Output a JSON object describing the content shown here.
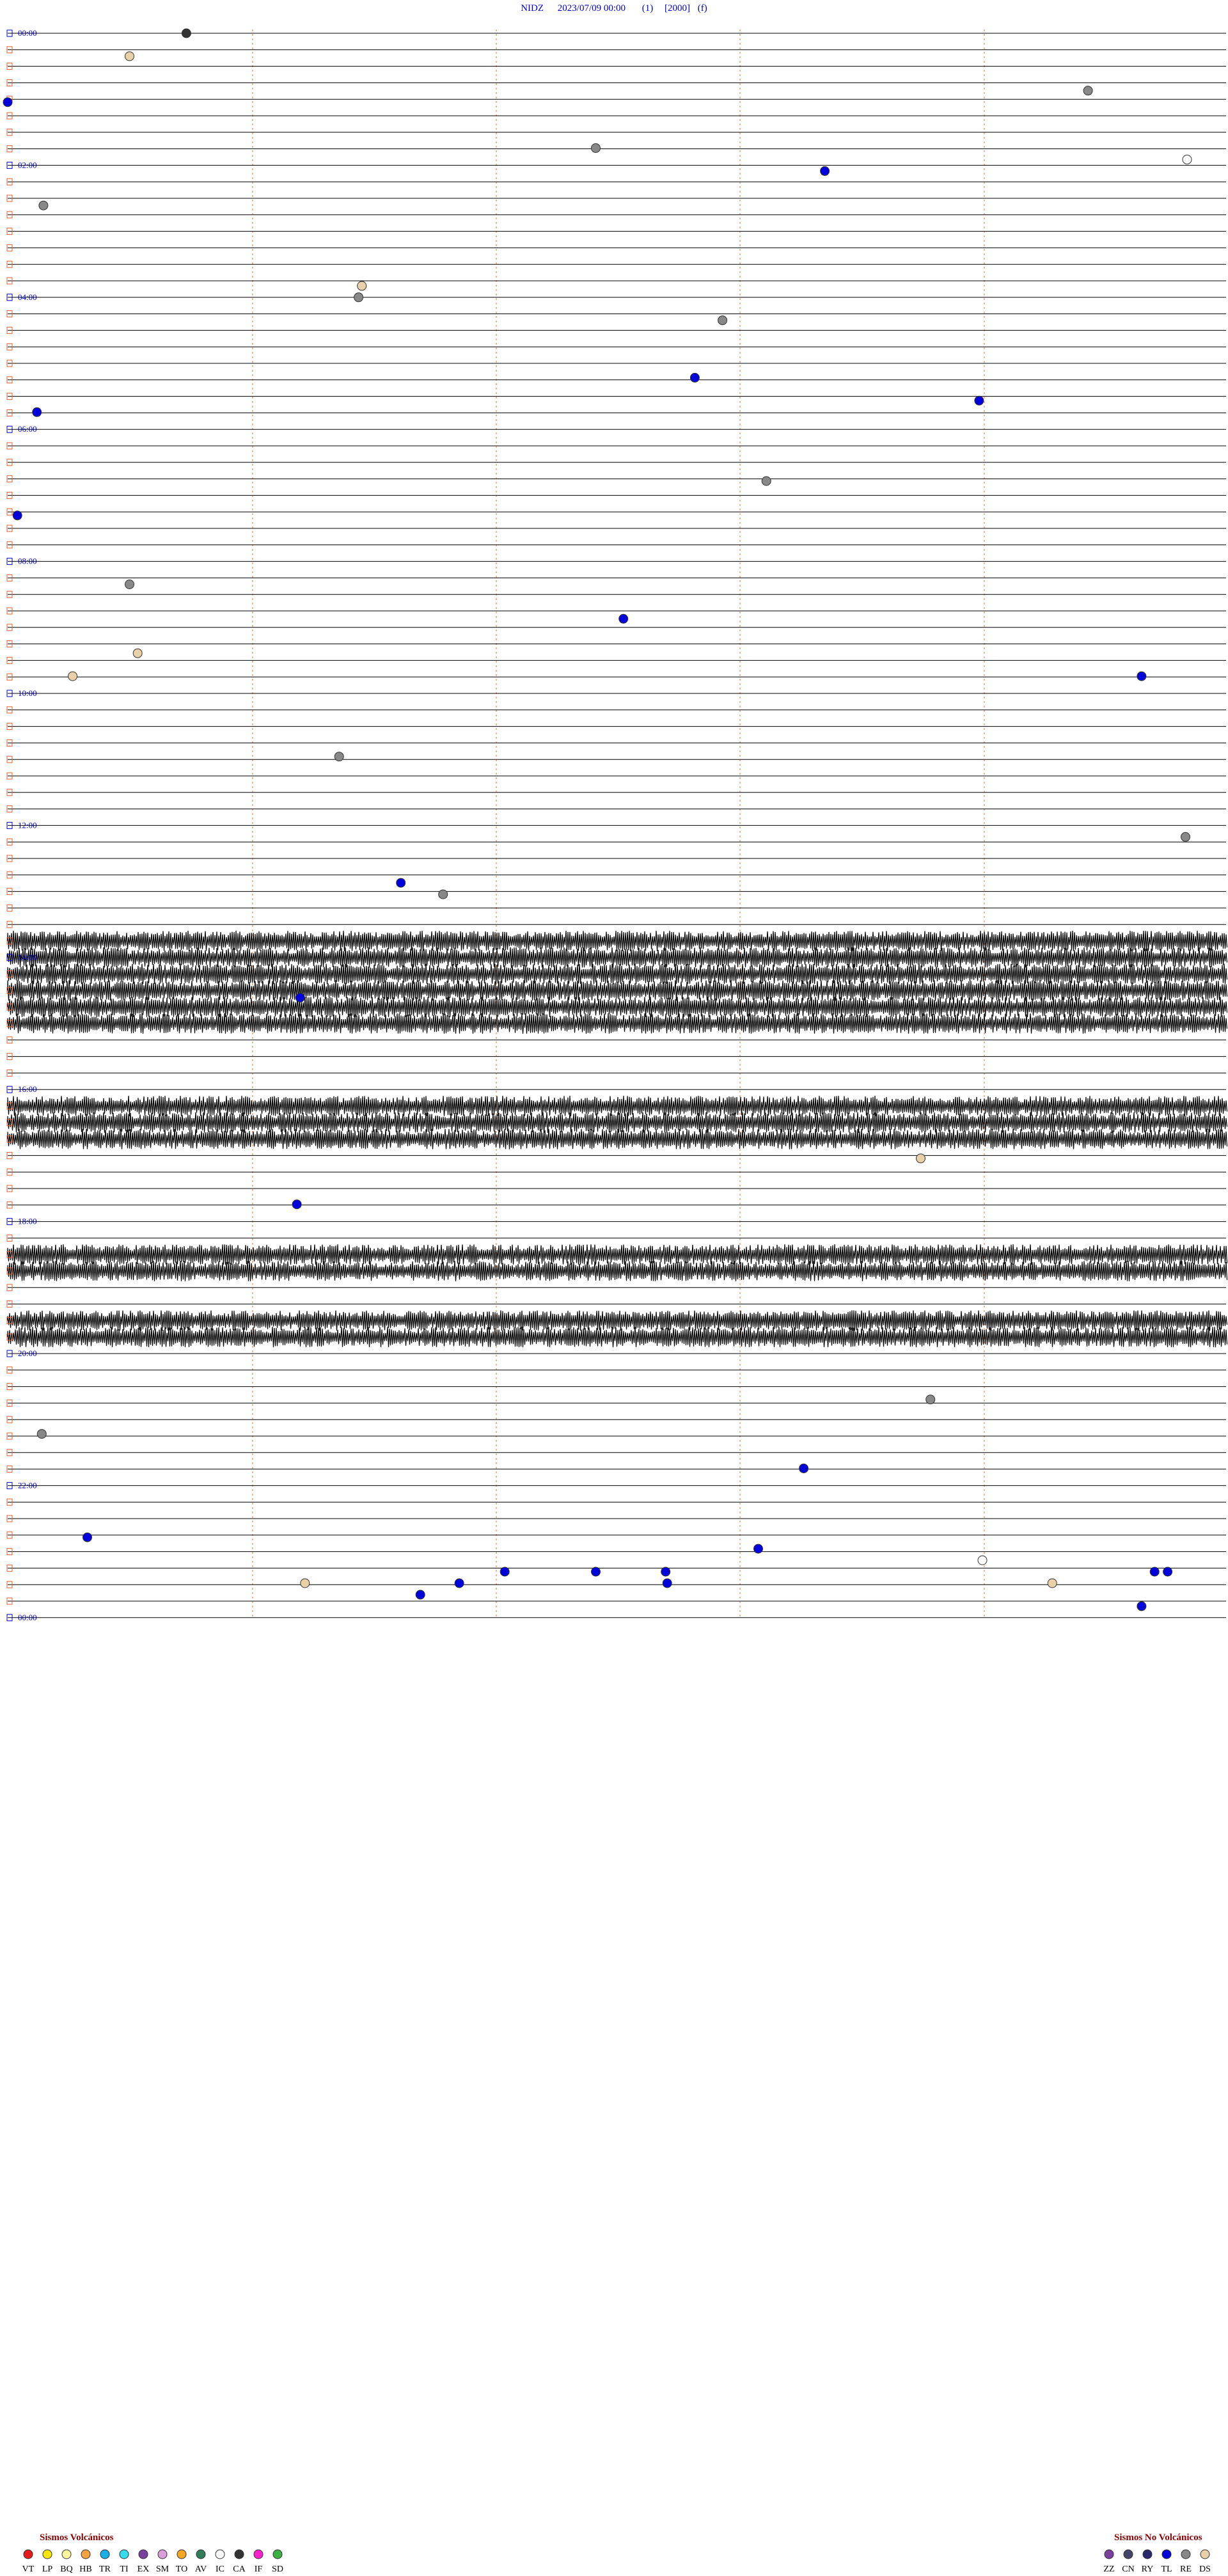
{
  "title": {
    "station": "NIDZ",
    "date": "2023/07/09 00:00",
    "param1": "(1)",
    "param2": "[2000]",
    "param3": "(f)"
  },
  "legend": {
    "volcanic_title": "Sismos Volcánicos",
    "volcanic": [
      {
        "code": "VT",
        "color": "#e41a1c"
      },
      {
        "code": "LP",
        "color": "#ffe600"
      },
      {
        "code": "BQ",
        "color": "#fff7a0"
      },
      {
        "code": "HB",
        "color": "#f4a340"
      },
      {
        "code": "TR",
        "color": "#1ab0e6"
      },
      {
        "code": "TI",
        "color": "#33ddee"
      },
      {
        "code": "EX",
        "color": "#7b3fa0"
      },
      {
        "code": "SM",
        "color": "#d9a0d9"
      },
      {
        "code": "TO",
        "color": "#f5a623"
      },
      {
        "code": "AV",
        "color": "#2e7d5b"
      },
      {
        "code": "IC",
        "color": "#ffffff"
      },
      {
        "code": "CA",
        "color": "#333333"
      },
      {
        "code": "IF",
        "color": "#ff22cc"
      },
      {
        "code": "SD",
        "color": "#3cb043"
      }
    ],
    "nonvolcanic_title": "Sismos No Volcánicos",
    "nonvolcanic": [
      {
        "code": "ZZ",
        "color": "#7b3fa0"
      },
      {
        "code": "CN",
        "color": "#444466"
      },
      {
        "code": "RY",
        "color": "#2a2a6a"
      },
      {
        "code": "TL",
        "color": "#0000dd"
      },
      {
        "code": "RE",
        "color": "#888888"
      },
      {
        "code": "DS",
        "color": "#e8d0a8"
      }
    ]
  },
  "chart_data": {
    "type": "scatter",
    "trace_rows": 96,
    "row_minutes": 15,
    "hour_labels": [
      "00:00",
      "02:00",
      "04:00",
      "06:00",
      "08:00",
      "10:00",
      "12:00",
      "14:00",
      "16:00",
      "18:00",
      "20:00",
      "22:00",
      "00:00"
    ],
    "noisy_row_ranges": [
      [
        55,
        60
      ],
      [
        65,
        67
      ],
      [
        74,
        75
      ],
      [
        78,
        79
      ]
    ],
    "events": [
      {
        "row": 0,
        "minute": 11.0,
        "type": "CA"
      },
      {
        "row": 2,
        "minute": 7.5,
        "type": "DS"
      },
      {
        "row": 5,
        "minute": 66.5,
        "type": "RE"
      },
      {
        "row": 6,
        "minute": 0.0,
        "type": "TL"
      },
      {
        "row": 10,
        "minute": 36.2,
        "type": "RE"
      },
      {
        "row": 11,
        "minute": 72.6,
        "type": "IC"
      },
      {
        "row": 12,
        "minute": 50.3,
        "type": "TL"
      },
      {
        "row": 15,
        "minute": 2.2,
        "type": "RE"
      },
      {
        "row": 22,
        "minute": 21.8,
        "type": "DS"
      },
      {
        "row": 23,
        "minute": 21.6,
        "type": "RE"
      },
      {
        "row": 25,
        "minute": 44.0,
        "type": "RE"
      },
      {
        "row": 30,
        "minute": 42.3,
        "type": "TL"
      },
      {
        "row": 32,
        "minute": 59.8,
        "type": "TL"
      },
      {
        "row": 33,
        "minute": 1.8,
        "type": "TL"
      },
      {
        "row": 39,
        "minute": 46.7,
        "type": "RE"
      },
      {
        "row": 42,
        "minute": 0.6,
        "type": "TL"
      },
      {
        "row": 48,
        "minute": 7.5,
        "type": "RE"
      },
      {
        "row": 51,
        "minute": 37.9,
        "type": "TL"
      },
      {
        "row": 54,
        "minute": 8.0,
        "type": "DS"
      },
      {
        "row": 56,
        "minute": 4.0,
        "type": "DS"
      },
      {
        "row": 56,
        "minute": 69.8,
        "type": "TL"
      },
      {
        "row": 63,
        "minute": 20.4,
        "type": "RE"
      },
      {
        "row": 70,
        "minute": 72.5,
        "type": "RE"
      },
      {
        "row": 74,
        "minute": 24.2,
        "type": "TL"
      },
      {
        "row": 75,
        "minute": 26.8,
        "type": "RE"
      },
      {
        "row": 84,
        "minute": 18.0,
        "type": "TL"
      },
      {
        "row": 98,
        "minute": 56.2,
        "type": "DS"
      },
      {
        "row": 102,
        "minute": 17.8,
        "type": "TL"
      },
      {
        "row": 119,
        "minute": 56.8,
        "type": "RE"
      },
      {
        "row": 122,
        "minute": 2.1,
        "type": "RE"
      },
      {
        "row": 125,
        "minute": 49.0,
        "type": "TL"
      },
      {
        "row": 131,
        "minute": 4.9,
        "type": "TL"
      },
      {
        "row": 132,
        "minute": 46.2,
        "type": "TL"
      },
      {
        "row": 133,
        "minute": 60.0,
        "type": "IC"
      },
      {
        "row": 134,
        "minute": 30.6,
        "type": "TL"
      },
      {
        "row": 134,
        "minute": 36.2,
        "type": "TL"
      },
      {
        "row": 134,
        "minute": 40.5,
        "type": "TL"
      },
      {
        "row": 134,
        "minute": 70.6,
        "type": "TL"
      },
      {
        "row": 134,
        "minute": 71.4,
        "type": "TL"
      },
      {
        "row": 135,
        "minute": 27.8,
        "type": "TL"
      },
      {
        "row": 135,
        "minute": 40.6,
        "type": "TL"
      },
      {
        "row": 135,
        "minute": 18.3,
        "type": "DS"
      },
      {
        "row": 135,
        "minute": 64.3,
        "type": "DS"
      },
      {
        "row": 136,
        "minute": 25.4,
        "type": "TL"
      },
      {
        "row": 137,
        "minute": 69.8,
        "type": "TL"
      }
    ]
  }
}
